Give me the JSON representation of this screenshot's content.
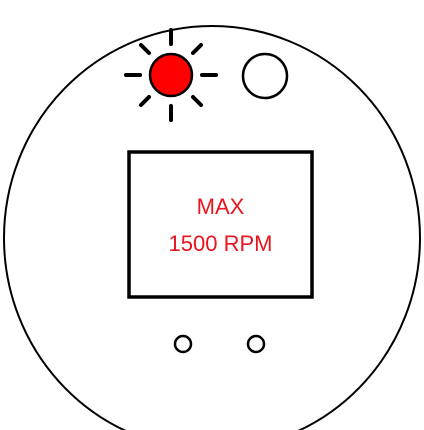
{
  "display": {
    "line1": "MAX",
    "line2": "1500 RPM"
  },
  "indicators": [
    {
      "name": "status-light-left",
      "state": "on",
      "color": "#ff0000",
      "icon": "light-on-icon"
    },
    {
      "name": "status-light-right",
      "state": "off",
      "color": "#ffffff",
      "icon": "light-off-icon"
    }
  ],
  "buttons": [
    {
      "name": "button-left",
      "icon": "button-circle-icon"
    },
    {
      "name": "button-right",
      "icon": "button-circle-icon"
    }
  ],
  "colors": {
    "stroke": "#000000",
    "display_text": "#e8141e",
    "light_on": "#ff0000",
    "background": "#ffffff"
  }
}
